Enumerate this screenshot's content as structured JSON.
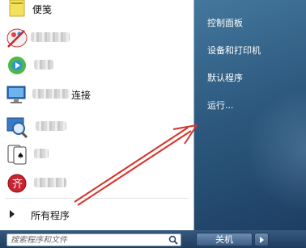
{
  "programs": [
    {
      "label": "便笺",
      "icon": "sticky-notes-icon"
    },
    {
      "label": "",
      "icon": "paint-icon"
    },
    {
      "label": "",
      "icon": "media-center-icon"
    },
    {
      "label": "连接",
      "icon": "remote-desktop-icon"
    },
    {
      "label": "",
      "icon": "magnifier-icon"
    },
    {
      "label": "",
      "icon": "solitaire-icon"
    },
    {
      "label": "",
      "icon": "red-app-icon"
    }
  ],
  "all_programs": {
    "label": "所有程序"
  },
  "search": {
    "placeholder": "搜索程序和文件"
  },
  "right_items": [
    "控制面板",
    "设备和打印机",
    "默认程序",
    "运行..."
  ],
  "shutdown": {
    "label": "关机"
  },
  "colors": {
    "annotation_arrow": "#d8332a",
    "right_pane": "#2e5a80"
  }
}
